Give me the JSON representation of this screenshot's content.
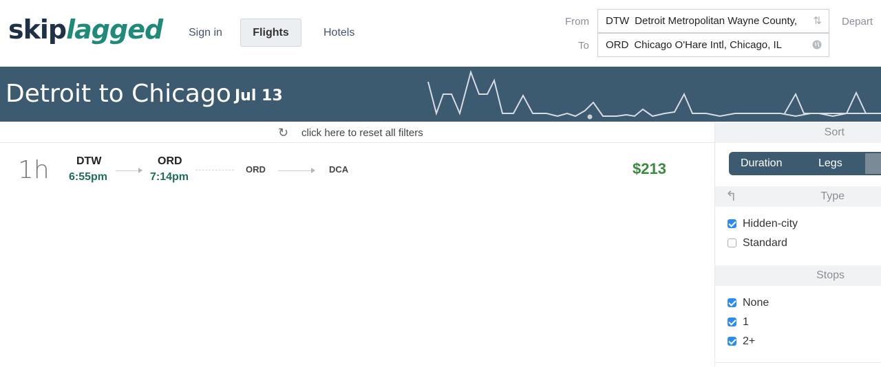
{
  "logo": {
    "part1": "skip",
    "part2": "lagged"
  },
  "nav": {
    "sign_in": "Sign in",
    "flights": "Flights",
    "hotels": "Hotels"
  },
  "search": {
    "from_label": "From",
    "to_label": "To",
    "depart_label": "Depart",
    "from_code": "DTW",
    "from_name": "Detroit Metropolitan Wayne County,",
    "to_code": "ORD",
    "to_name": "Chicago O'Hare Intl, Chicago, IL",
    "swap_icon": "swap-arrows-icon",
    "globe_icon": "globe-icon"
  },
  "banner": {
    "title": "Detroit to Chicago",
    "date": "Jul 13",
    "bg_color": "#3c5a70"
  },
  "filters": {
    "reset_text": "click here to reset all filters",
    "reset_icon": "reset-icon"
  },
  "result": {
    "duration": "1h",
    "segment1": {
      "from_code": "DTW",
      "from_time": "6:55pm",
      "to_code": "ORD",
      "to_time": "7:14pm"
    },
    "segment2": {
      "from_code": "ORD",
      "to_code": "DCA"
    },
    "price": "$213",
    "price_color": "#3b8a3e"
  },
  "sidebar": {
    "sort": {
      "heading": "Sort",
      "options": [
        "Duration",
        "Legs"
      ]
    },
    "type": {
      "heading": "Type",
      "options": [
        {
          "label": "Hidden-city",
          "checked": true
        },
        {
          "label": "Standard",
          "checked": false
        }
      ]
    },
    "stops": {
      "heading": "Stops",
      "options": [
        {
          "label": "None",
          "checked": true
        },
        {
          "label": "1",
          "checked": true
        },
        {
          "label": "2+",
          "checked": true
        }
      ]
    }
  }
}
